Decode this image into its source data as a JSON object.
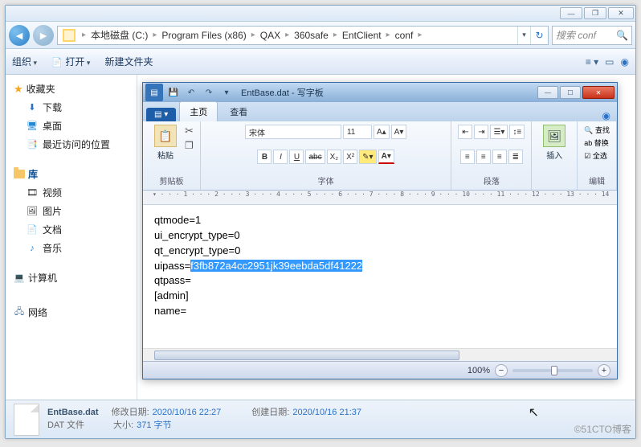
{
  "explorer": {
    "titlebar_min": "—",
    "titlebar_max": "❐",
    "titlebar_close": "✕",
    "breadcrumb": [
      "本地磁盘 (C:)",
      "Program Files (x86)",
      "QAX",
      "360safe",
      "EntClient",
      "conf"
    ],
    "search_placeholder": "搜索 conf",
    "toolbar": {
      "organize": "组织",
      "open": "打开",
      "newfolder": "新建文件夹"
    },
    "sidebar": {
      "favorites": "收藏夹",
      "fav_items": [
        "下载",
        "桌面",
        "最近访问的位置"
      ],
      "libraries": "库",
      "lib_items": [
        "视频",
        "图片",
        "文档",
        "音乐"
      ],
      "computer": "计算机",
      "network": "网络"
    },
    "status": {
      "filename": "EntBase.dat",
      "filetype": "DAT 文件",
      "mdate_label": "修改日期:",
      "mdate": "2020/10/16 22:27",
      "cdate_label": "创建日期:",
      "cdate": "2020/10/16 21:37",
      "size_label": "大小:",
      "size": "371 字节"
    }
  },
  "wordpad": {
    "title": "EntBase.dat - 写字板",
    "filebtn": "▤ ▾",
    "tabs": {
      "home": "主页",
      "view": "查看"
    },
    "ribbon": {
      "clipboard_label": "剪贴板",
      "paste": "粘贴",
      "font_label": "字体",
      "font_name": "宋体",
      "font_size": "11",
      "paragraph_label": "段落",
      "insert_label": "插入",
      "editing_label": "编辑",
      "find": "查找",
      "replace": "替换",
      "selectall": "全选"
    },
    "doc": {
      "l1": "qtmode=1",
      "l2": "ui_encrypt_type=0",
      "l3": "qt_encrypt_type=0",
      "l4a": "uipass=",
      "l4b": "f3fb872a4cc2951jk39eebda5df41222",
      "l5": "qtpass=",
      "l6": "[admin]",
      "l7": "name="
    },
    "zoom_label": "100%"
  },
  "watermark": "©51CTO博客"
}
